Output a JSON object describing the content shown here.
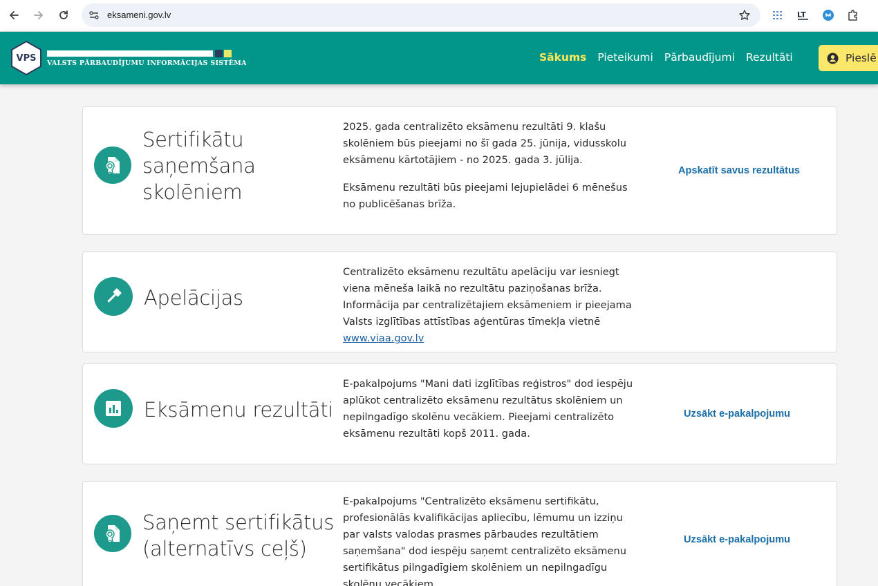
{
  "browser": {
    "url": "eksameni.gov.lv"
  },
  "site": {
    "logo_abbr": "VPS",
    "logo_text": "VALSTS PĀRBAUDĪJUMU INFORMĀCIJAS SISTĒMA",
    "brand_color": "#02968a",
    "accent_color": "#ffe95a",
    "nav": [
      {
        "label": "Sākums",
        "active": true
      },
      {
        "label": "Pieteikumi",
        "active": false
      },
      {
        "label": "Pārbaudījumi",
        "active": false
      },
      {
        "label": "Rezultāti",
        "active": false
      }
    ],
    "login_label": "Pieslē"
  },
  "cards": [
    {
      "title_lines": [
        "Sertifikātu",
        "saņemšana",
        "skolēniem"
      ],
      "icon": "certificate-icon",
      "paragraphs": [
        "2025. gada centralizēto eksāmenu rezultāti 9. klašu skolēniem būs pieejami no šī gada 25. jūnija, vidusskolu eksāmenu kārtotājiem - no 2025. gada 3. jūlija.",
        "Eksāmenu rezultāti būs pieejami lejupielādei 6 mēnešus no publicēšanas brīža."
      ],
      "action": "Apskatīt savus rezultātus"
    },
    {
      "title_lines": [
        "Apelācijas"
      ],
      "icon": "gavel-icon",
      "paragraph_text": "Centralizēto eksāmenu rezultātu apelāciju var iesniegt viena mēneša laikā no rezultātu paziņošanas brīža. Informācija par centralizētajiem eksāmeniem ir pieejama Valsts izglītības attīstības aģentūras tīmekļa vietnē ",
      "link": "www.viaa.gov.lv",
      "action": ""
    },
    {
      "title_lines": [
        "Eksāmenu rezultāti"
      ],
      "icon": "bar-chart-icon",
      "paragraphs": [
        "E-pakalpojums \"Mani dati izglītības reģistros\" dod iespēju aplūkot centralizēto eksāmenu rezultātus skolēniem un nepilngadīgo skolēnu vecākiem. Pieejami centralizēto eksāmenu rezultāti kopš 2011. gada."
      ],
      "action": "Uzsākt e-pakalpojumu"
    },
    {
      "title_lines": [
        "Saņemt sertifikātus",
        "(alternatīvs ceļš)"
      ],
      "icon": "certificate-icon",
      "paragraphs": [
        "E-pakalpojums \"Centralizēto eksāmenu sertifikātu, profesionālās kvalifikācijas apliecību, lēmumu un izziņu par valsts valodas prasmes pārbaudes rezultātiem saņemšana\" dod iespēju saņemt centralizēto eksāmenu sertifikātus pilngadīgiem skolēniem un nepilngadīgu skolēnu vecākiem."
      ],
      "action": "Uzsākt e-pakalpojumu"
    }
  ]
}
